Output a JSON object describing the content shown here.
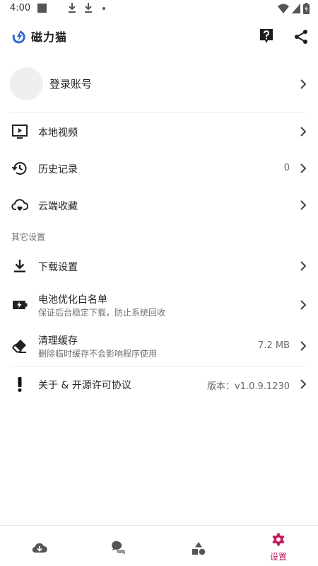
{
  "status_bar": {
    "time": "4:00"
  },
  "app": {
    "title": "磁力猫",
    "brand_color": "#2f6bd6",
    "accent_color": "#c2185b"
  },
  "account": {
    "label": "登录账号"
  },
  "menu": [
    {
      "title": "本地视频",
      "icon": "video-icon"
    },
    {
      "title": "历史记录",
      "value": "0",
      "icon": "history-icon"
    },
    {
      "title": "云端收藏",
      "icon": "cloud-favorite-icon"
    }
  ],
  "section_header": "其它设置",
  "settings": [
    {
      "title": "下载设置",
      "icon": "download-icon"
    },
    {
      "title": "电池优化白名单",
      "subtitle": "保证后台稳定下载，防止系统回收",
      "icon": "battery-icon"
    },
    {
      "title": "清理缓存",
      "subtitle": "删除临时缓存不会影响程序使用",
      "value": "7.2 MB",
      "icon": "eraser-icon"
    },
    {
      "title": "关于 & 开源许可协议",
      "value": "版本：v1.0.9.1230",
      "icon": "exclamation-icon"
    }
  ],
  "bottom_nav": [
    {
      "icon": "cloud-download-icon"
    },
    {
      "icon": "chat-icon"
    },
    {
      "icon": "shapes-icon"
    },
    {
      "icon": "settings-gear-icon",
      "label": "设置",
      "active": true
    }
  ]
}
